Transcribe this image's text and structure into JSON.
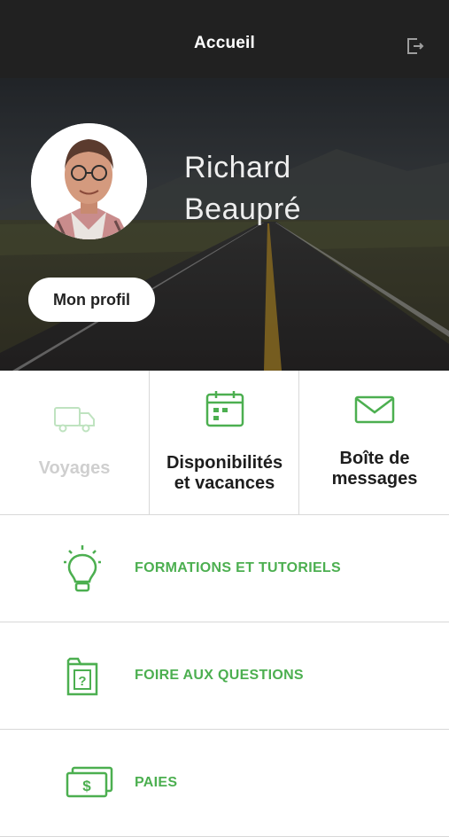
{
  "header": {
    "title": "Accueil",
    "logout_icon": "logout-icon"
  },
  "profile": {
    "first_name": "Richard",
    "last_name": "Beaupré",
    "profile_button_label": "Mon profil"
  },
  "tiles": [
    {
      "label_line1": "Voyages",
      "label_line2": "",
      "icon": "truck-icon",
      "enabled": false
    },
    {
      "label_line1": "Disponibilités",
      "label_line2": "et vacances",
      "icon": "calendar-icon",
      "enabled": true
    },
    {
      "label_line1": "Boîte de",
      "label_line2": "messages",
      "icon": "envelope-icon",
      "enabled": true
    }
  ],
  "menu": [
    {
      "label": "FORMATIONS ET TUTORIELS",
      "icon": "lightbulb-icon"
    },
    {
      "label": "FOIRE AUX QUESTIONS",
      "icon": "question-folder-icon"
    },
    {
      "label": "PAIES",
      "icon": "money-icon"
    }
  ],
  "colors": {
    "accent": "#4caf50",
    "header_bg": "#212121",
    "disabled": "#cfcfcf"
  }
}
